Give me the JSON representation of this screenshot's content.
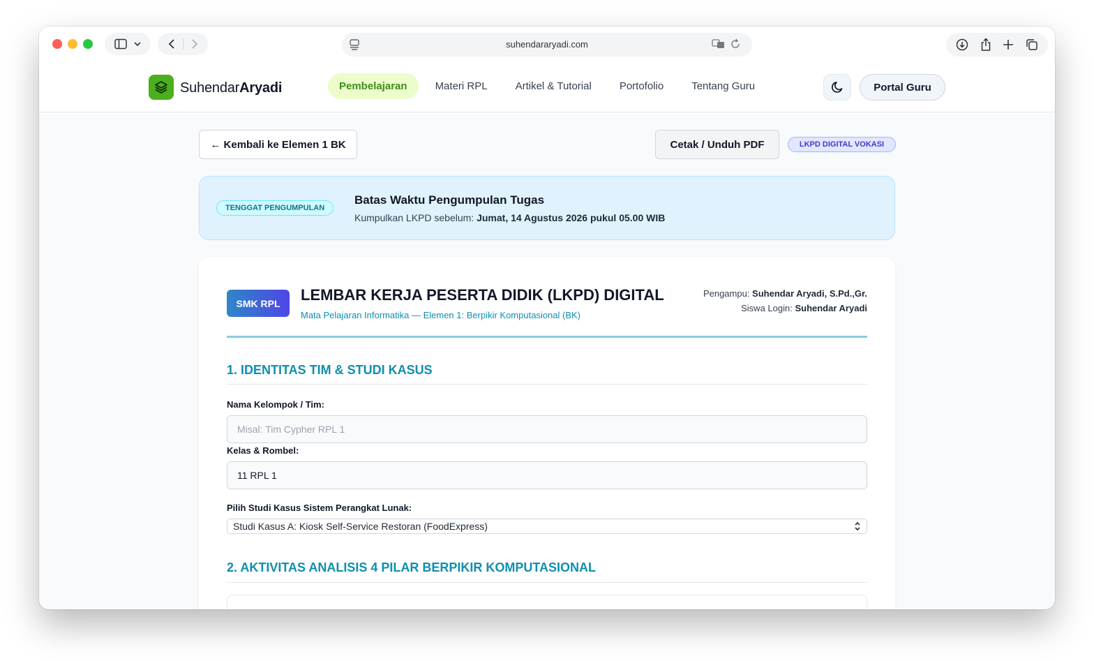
{
  "browser": {
    "url": "suhendararyadi.com"
  },
  "navbar": {
    "logo_light": "Suhendar",
    "logo_bold": "Aryadi",
    "links": [
      "Pembelajaran",
      "Materi RPL",
      "Artikel & Tutorial",
      "Portofolio",
      "Tentang Guru"
    ],
    "portal_label": "Portal Guru"
  },
  "toolbar": {
    "back_label": "← Kembali ke Elemen 1 BK",
    "print_label": "Cetak / Unduh PDF",
    "badge_label": "LKPD DIGITAL VOKASI"
  },
  "deadline": {
    "badge": "TENGGAT PENGUMPULAN",
    "title": "Batas Waktu Pengumpulan Tugas",
    "text_prefix": "Kumpulkan LKPD sebelum: ",
    "text_bold": "Jumat, 14 Agustus 2026 pukul 05.00 WIB"
  },
  "sheet": {
    "badge": "SMK RPL",
    "title": "LEMBAR KERJA PESERTA DIDIK (LKPD) DIGITAL",
    "subtitle": "Mata Pelajaran Informatika — Elemen 1: Berpikir Komputasional (BK)",
    "pengampu_label": "Pengampu: ",
    "pengampu_name": "Suhendar Aryadi, S.Pd.,Gr.",
    "siswa_label": "Siswa Login: ",
    "siswa_name": "Suhendar Aryadi"
  },
  "section1": {
    "title": "1. IDENTITAS TIM & STUDI KASUS",
    "team_label": "Nama Kelompok / Tim:",
    "team_placeholder": "Misal: Tim Cypher RPL 1",
    "team_value": "",
    "class_label": "Kelas & Rombel:",
    "class_value": "11 RPL 1",
    "case_label": "Pilih Studi Kasus Sistem Perangkat Lunak:",
    "case_selected": "Studi Kasus A: Kiosk Self-Service Restoran (FoodExpress)"
  },
  "section2": {
    "title": "2. AKTIVITAS ANALISIS 4 PILAR BERPIKIR KOMPUTASIONAL"
  }
}
